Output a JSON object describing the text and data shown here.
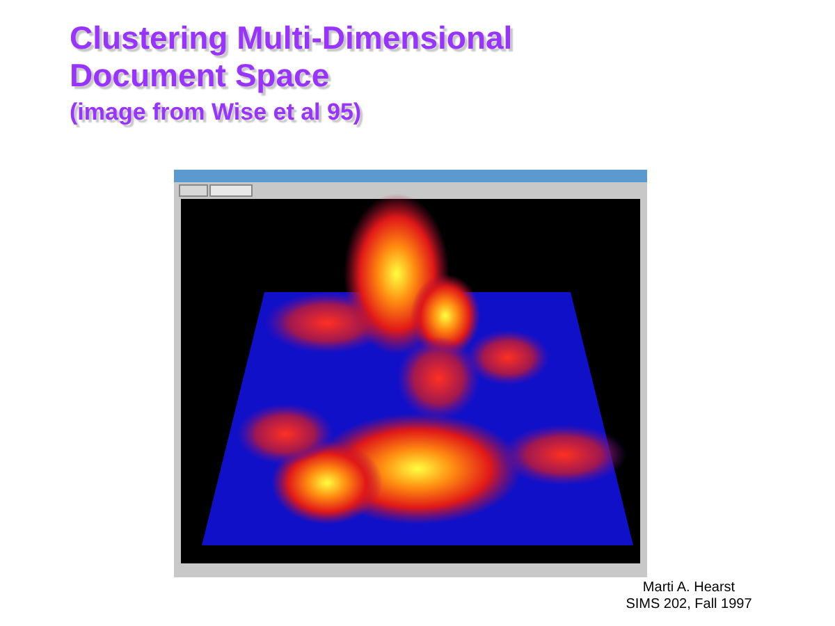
{
  "title_lines": [
    "Clustering Multi-Dimensional",
    "Document Space"
  ],
  "subtitle": "(image from Wise et al 95)",
  "credit_lines": [
    "Marti A. Hearst",
    "SIMS 202, Fall 1997"
  ]
}
